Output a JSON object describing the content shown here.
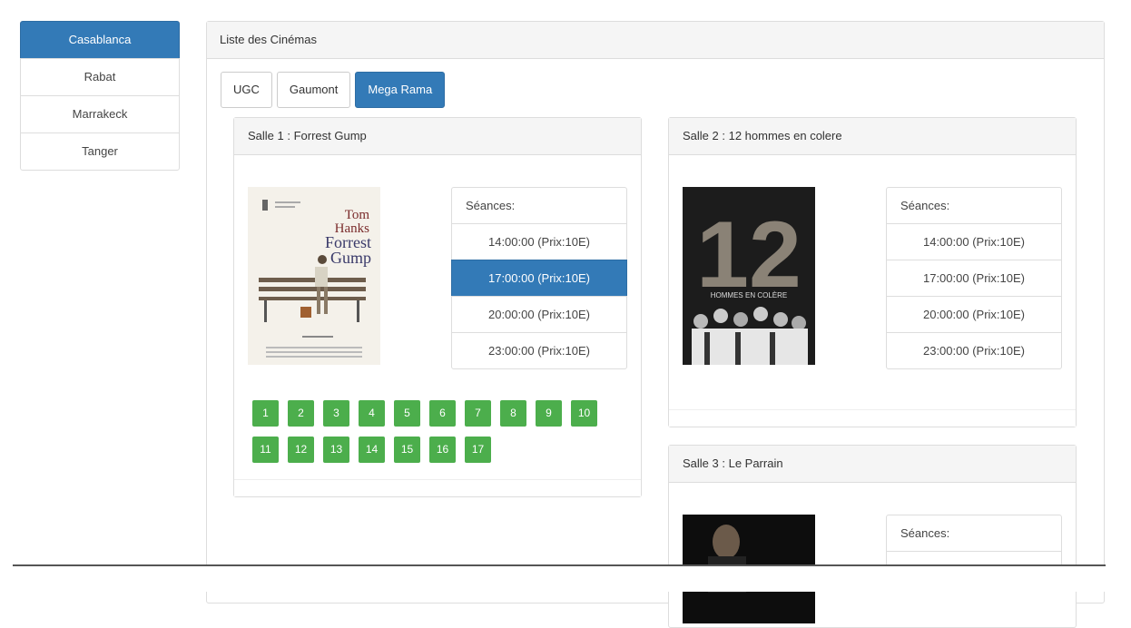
{
  "cities": [
    {
      "label": "Casablanca",
      "active": true
    },
    {
      "label": "Rabat",
      "active": false
    },
    {
      "label": "Marrakeck",
      "active": false
    },
    {
      "label": "Tanger",
      "active": false
    }
  ],
  "main": {
    "title": "Liste des Cinémas",
    "tabs": [
      {
        "label": "UGC",
        "active": false
      },
      {
        "label": "Gaumont",
        "active": false
      },
      {
        "label": "Mega Rama",
        "active": true
      }
    ]
  },
  "salles": [
    {
      "title": "Salle 1 : Forrest Gump",
      "seances_label": "Séances:",
      "seances": [
        "14:00:00 (Prix:10E)",
        "17:00:00 (Prix:10E)",
        "20:00:00 (Prix:10E)",
        "23:00:00 (Prix:10E)"
      ],
      "selected_seance": "17:00:00 (Prix:10E)",
      "poster": {
        "line1": "Tom",
        "line2": "Hanks",
        "line3": "Forrest",
        "line4": "Gump"
      },
      "seats": [
        "1",
        "2",
        "3",
        "4",
        "5",
        "6",
        "7",
        "8",
        "9",
        "10",
        "11",
        "12",
        "13",
        "14",
        "15",
        "16",
        "17"
      ]
    },
    {
      "title": "Salle 2 : 12 hommes en colere",
      "seances_label": "Séances:",
      "seances": [
        "14:00:00 (Prix:10E)",
        "17:00:00 (Prix:10E)",
        "20:00:00 (Prix:10E)",
        "23:00:00 (Prix:10E)"
      ],
      "poster": {
        "number": "12",
        "caption": "HOMMES EN COLÈRE"
      }
    },
    {
      "title": "Salle 3 : Le Parrain",
      "seances_label": "Séances:"
    }
  ],
  "colors": {
    "primary": "#337ab7",
    "seat_green": "#4cae4c",
    "panel_head": "#f5f5f5",
    "border": "#dddddd"
  }
}
